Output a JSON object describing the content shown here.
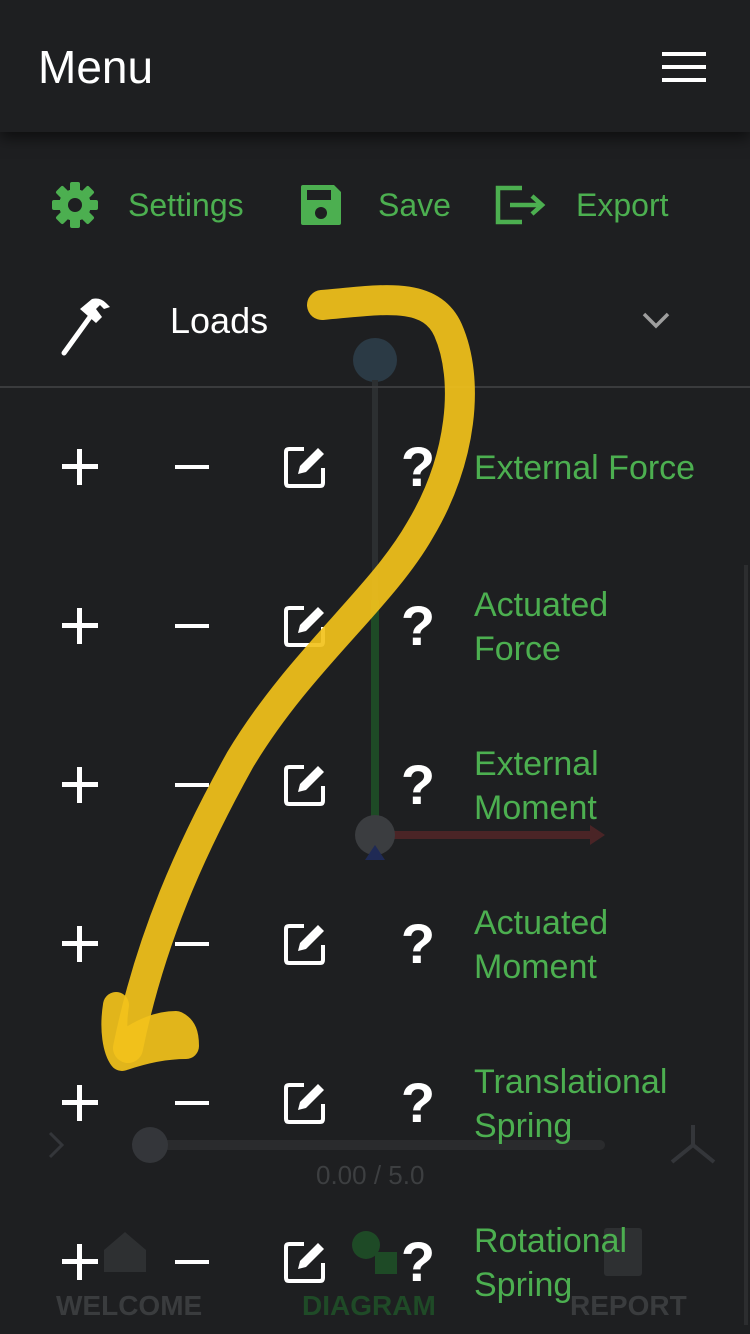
{
  "header": {
    "title": "Menu",
    "menu_icon": "hamburger-icon"
  },
  "actions": {
    "settings": {
      "label": "Settings",
      "icon": "gear-icon"
    },
    "save": {
      "label": "Save",
      "icon": "floppy-disk-icon"
    },
    "export": {
      "label": "Export",
      "icon": "export-icon"
    }
  },
  "loads_dropdown": {
    "label": "Loads",
    "icon": "hammer-icon",
    "chevron": "chevron-down-icon"
  },
  "load_items": [
    {
      "line1": "External Force",
      "line2": ""
    },
    {
      "line1": "Actuated",
      "line2": "Force"
    },
    {
      "line1": "External",
      "line2": "Moment"
    },
    {
      "line1": "Actuated",
      "line2": "Moment"
    },
    {
      "line1": "Translational",
      "line2": "Spring"
    },
    {
      "line1": "Rotational",
      "line2": "Spring"
    }
  ],
  "row_controls": {
    "add": "+",
    "remove": "−",
    "edit_icon": "edit-icon",
    "help": "?"
  },
  "background": {
    "time_readout": "0.00 / 5.0",
    "tabs": {
      "welcome": "WELCOME",
      "diagram": "DIAGRAM",
      "report": "REPORT"
    }
  },
  "colors": {
    "accent": "#4caf50",
    "background": "#1e1f21",
    "annotation": "#f2c21b"
  }
}
